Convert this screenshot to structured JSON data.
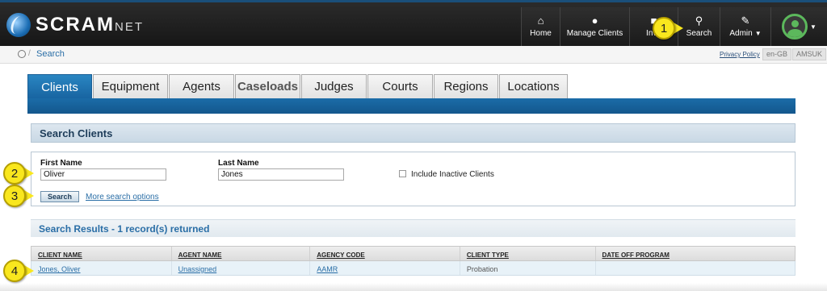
{
  "app": {
    "logo_main": "SCRAM",
    "logo_suffix": "NET"
  },
  "nav": {
    "home": "Home",
    "manage_clients": "Manage Clients",
    "inventory": "Inve",
    "search": "Search",
    "admin": "Admin"
  },
  "callouts": [
    "1",
    "2",
    "3",
    "4"
  ],
  "breadcrumb": {
    "current": "Search",
    "privacy": "Privacy Policy",
    "locale": "en-GB",
    "org": "AMSUK"
  },
  "tabs": [
    {
      "label": "Clients",
      "active": true
    },
    {
      "label": "Equipment"
    },
    {
      "label": "Agents"
    },
    {
      "label": "Caseloads"
    },
    {
      "label": "Judges"
    },
    {
      "label": "Courts"
    },
    {
      "label": "Regions"
    },
    {
      "label": "Locations"
    }
  ],
  "search_form": {
    "title": "Search Clients",
    "first_name_label": "First Name",
    "first_name_value": "Oliver",
    "last_name_label": "Last Name",
    "last_name_value": "Jones",
    "include_inactive_label": "Include Inactive Clients",
    "include_inactive_checked": false,
    "search_button": "Search",
    "more_options": "More search options"
  },
  "results": {
    "title": "Search Results - 1 record(s) returned",
    "columns": [
      "CLIENT NAME",
      "AGENT NAME",
      "AGENCY CODE",
      "CLIENT TYPE",
      "DATE OFF PROGRAM"
    ],
    "rows": [
      {
        "client_name": "Jones, Oliver",
        "agent_name": "Unassigned",
        "agency_code": "AAMR",
        "client_type": "Probation",
        "date_off_program": ""
      }
    ]
  },
  "colors": {
    "accent": "#1763a0",
    "callout": "#f9e71e",
    "topbar": "#1a1a1a"
  },
  "icons": [
    "home-icon",
    "user-icon",
    "truck-icon",
    "search-icon",
    "wrench-icon",
    "avatar-icon",
    "checkbox-icon"
  ]
}
